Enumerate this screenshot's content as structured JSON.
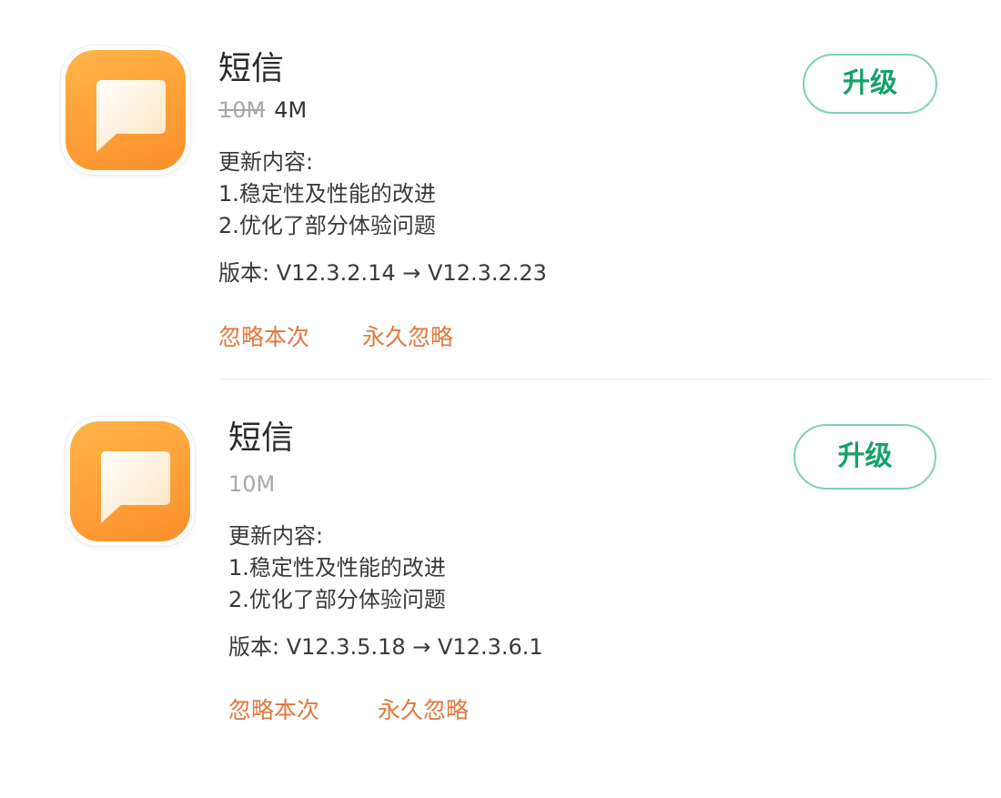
{
  "updates": [
    {
      "app_name": "短信",
      "size_old": "10M",
      "size_new": "4M",
      "notes_heading": "更新内容:",
      "notes": [
        "1.稳定性及性能的改进",
        "2.优化了部分体验问题"
      ],
      "version_text": "版本: V12.3.2.14 → V12.3.2.23",
      "upgrade_label": "升级",
      "ignore_once_label": "忽略本次",
      "ignore_forever_label": "永久忽略",
      "icon": "message-app-icon"
    },
    {
      "app_name": "短信",
      "size": "10M",
      "notes_heading": "更新内容:",
      "notes": [
        "1.稳定性及性能的改进",
        "2.优化了部分体验问题"
      ],
      "version_text": "版本: V12.3.5.18 → V12.3.6.1",
      "upgrade_label": "升级",
      "ignore_once_label": "忽略本次",
      "ignore_forever_label": "永久忽略",
      "icon": "message-app-icon"
    }
  ],
  "colors": {
    "accent_green": "#16a06a",
    "button_border": "#7fd3ad",
    "link_orange": "#e2773e",
    "icon_orange": "#ffa33a"
  }
}
